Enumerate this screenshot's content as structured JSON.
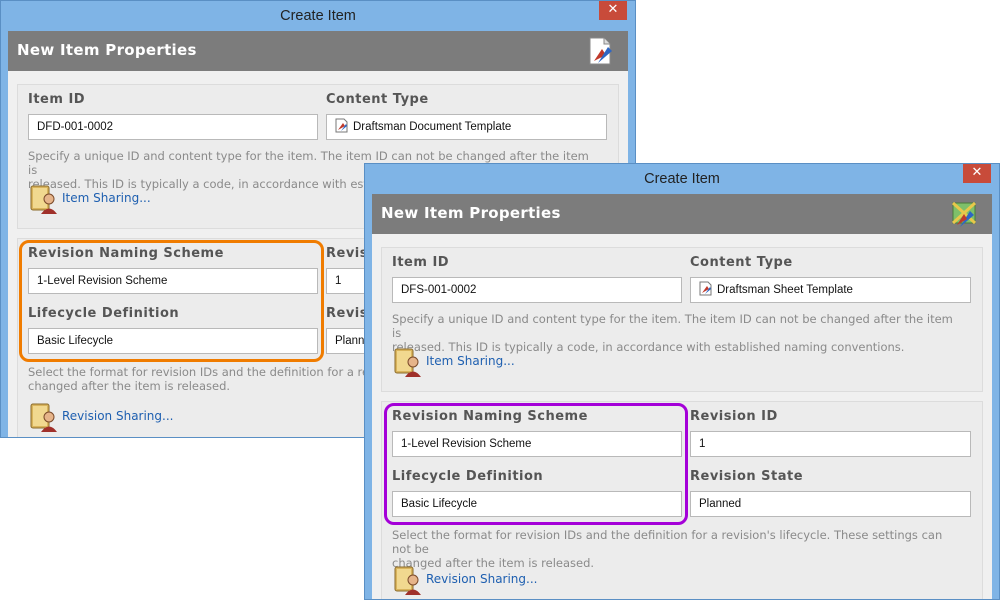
{
  "dialog1": {
    "title": "Create Item",
    "close_glyph": "✕",
    "header_title": "New Item Properties",
    "item_id_label": "Item ID",
    "item_id_value": "DFD-001-0002",
    "content_type_label": "Content Type",
    "content_type_value": "Draftsman Document Template",
    "item_desc_line1": "Specify a unique ID and content type for the item. The item ID can not be changed after the item is",
    "item_desc_line2": "released. This ID is typically a code, in accordance with estab",
    "item_sharing": "Item Sharing...",
    "revision_scheme_label": "Revision Naming Scheme",
    "revision_scheme_value": "1-Level Revision Scheme",
    "revision_id_label_partial": "Revis",
    "revision_id_value": "1",
    "lifecycle_label": "Lifecycle Definition",
    "lifecycle_value": "Basic Lifecycle",
    "revision_state_label_partial": "Revis",
    "revision_state_value_partial": "Planne",
    "revision_desc_line1": "Select the format for revision IDs and the definition for a revis",
    "revision_desc_line2": "changed after the item is released.",
    "revision_sharing": "Revision Sharing..."
  },
  "dialog2": {
    "title": "Create Item",
    "close_glyph": "✕",
    "header_title": "New Item Properties",
    "item_id_label": "Item ID",
    "item_id_value": "DFS-001-0002",
    "content_type_label": "Content Type",
    "content_type_value": "Draftsman Sheet Template",
    "item_desc_line1": "Specify a unique ID and content type for the item. The item ID can not be changed after the item is",
    "item_desc_line2": "released. This ID is typically a code, in accordance with established naming conventions.",
    "item_sharing": "Item Sharing...",
    "revision_scheme_label": "Revision Naming Scheme",
    "revision_scheme_value": "1-Level Revision Scheme",
    "revision_id_label": "Revision ID",
    "revision_id_value": "1",
    "lifecycle_label": "Lifecycle Definition",
    "lifecycle_value": "Basic Lifecycle",
    "revision_state_label": "Revision State",
    "revision_state_value": "Planned",
    "revision_desc_line1": "Select the format for revision IDs and the definition for a revision's lifecycle. These settings can not be",
    "revision_desc_line2": "changed after the item is released.",
    "revision_sharing": "Revision Sharing..."
  },
  "colors": {
    "window_frame": "#7fb4e6",
    "header_bar": "#7c7c7c",
    "close_button": "#c84b3a",
    "link": "#1e5fb0",
    "highlight_orange": "#f07c00",
    "highlight_purple": "#a400d8"
  },
  "icons": {
    "close": "close-icon",
    "header_document": "document-template-icon",
    "header_sheet": "sheet-template-icon",
    "content_type": "document-icon",
    "sharing": "sharing-book-icon"
  }
}
